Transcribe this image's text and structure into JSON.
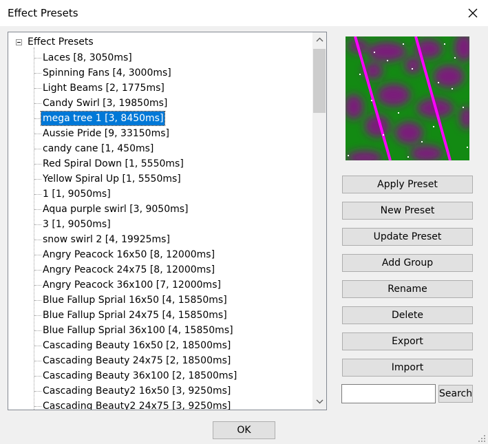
{
  "window": {
    "title": "Effect Presets",
    "close_icon": "close-icon"
  },
  "tree": {
    "root_label": "Effect Presets",
    "selected_index": 4,
    "items": [
      "Laces [8, 3050ms]",
      "Spinning Fans [4, 3000ms]",
      "Light Beams [2, 1775ms]",
      "Candy Swirl [3, 19850ms]",
      "mega tree 1 [3, 8450ms]",
      "Aussie Pride [9, 33150ms]",
      "candy cane [1, 450ms]",
      "Red Spiral Down [1, 5550ms]",
      "Yellow Spiral Up [1, 5550ms]",
      "1 [1, 9050ms]",
      "Aqua purple swirl [3, 9050ms]",
      "3 [1, 9050ms]",
      "snow swirl 2 [4, 19925ms]",
      "Angry Peacock 16x50 [8, 12000ms]",
      "Angry Peacock 24x75 [8, 12000ms]",
      "Angry Peacock 36x100 [7, 12000ms]",
      "Blue Fallup Sprial 16x50 [4, 15850ms]",
      "Blue Fallup Sprial 24x75 [4, 15850ms]",
      "Blue Fallup Sprial 36x100 [4, 15850ms]",
      "Cascading Beauty 16x50 [2, 18500ms]",
      "Cascading Beauty 24x75 [2, 18500ms]",
      "Cascading Beauty 36x100 [2, 18500ms]",
      "Cascading Beauty2 16x50 [3, 9250ms]",
      "Cascading Beauty2 24x75 [3, 9250ms]"
    ]
  },
  "buttons": {
    "apply": "Apply Preset",
    "new": "New Preset",
    "update": "Update Preset",
    "add_group": "Add Group",
    "rename": "Rename",
    "delete": "Delete",
    "export": "Export",
    "import": "Import",
    "search": "Search",
    "ok": "OK"
  },
  "search": {
    "value": ""
  },
  "colors": {
    "selection": "#0078d7",
    "preview_green": "#138a13",
    "preview_purple": "#7a1b7a",
    "preview_magenta": "#ff00ff"
  }
}
